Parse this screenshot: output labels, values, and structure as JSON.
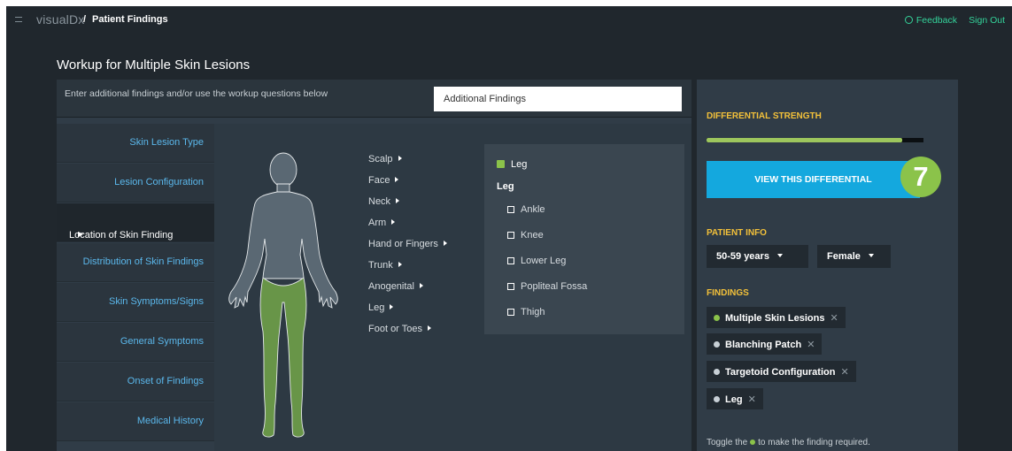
{
  "header": {
    "logo": "visualDx",
    "separator": "/",
    "breadcrumb": "Patient Findings",
    "feedback_label": "Feedback",
    "signout_label": "Sign Out"
  },
  "page_title": "Workup for Multiple Skin Lesions",
  "workup": {
    "prompt": "Enter additional findings and/or use the workup questions below",
    "search_placeholder": "Additional Findings",
    "nav": [
      {
        "label": "Skin Lesion Type"
      },
      {
        "label": "Lesion Configuration"
      },
      {
        "label": "Location of Skin Finding",
        "active": true
      },
      {
        "label": "Distribution of Skin Findings"
      },
      {
        "label": "Skin Symptoms/Signs"
      },
      {
        "label": "General Symptoms"
      },
      {
        "label": "Onset of Findings"
      },
      {
        "label": "Medical History"
      }
    ],
    "regions": [
      "Scalp",
      "Face",
      "Neck",
      "Arm",
      "Hand or Fingers",
      "Trunk",
      "Anogenital",
      "Leg",
      "Foot or Toes"
    ],
    "subpanel": {
      "checked_label": "Leg",
      "title": "Leg",
      "options": [
        "Ankle",
        "Knee",
        "Lower Leg",
        "Popliteal Fossa",
        "Thigh"
      ]
    }
  },
  "right_panel": {
    "differential_label": "DIFFERENTIAL STRENGTH",
    "strength_fraction": 0.9,
    "view_button": "VIEW THIS DIFFERENTIAL",
    "badge": "7",
    "patient_info_label": "PATIENT INFO",
    "age": "50-59 years",
    "sex": "Female",
    "findings_label": "FINDINGS",
    "findings": [
      {
        "label": "Multiple Skin Lesions",
        "required": true
      },
      {
        "label": "Blanching Patch",
        "required": false
      },
      {
        "label": "Targetoid Configuration",
        "required": false
      },
      {
        "label": "Leg",
        "required": false
      }
    ],
    "toggle_note_pre": "Toggle the",
    "toggle_note_post": "to make the finding required."
  },
  "colors": {
    "accent_green": "#8bc34a",
    "link_blue": "#5bb8ec",
    "label_gold": "#f3c13a",
    "button_blue": "#14a8de",
    "feedback_green": "#34d39a"
  }
}
